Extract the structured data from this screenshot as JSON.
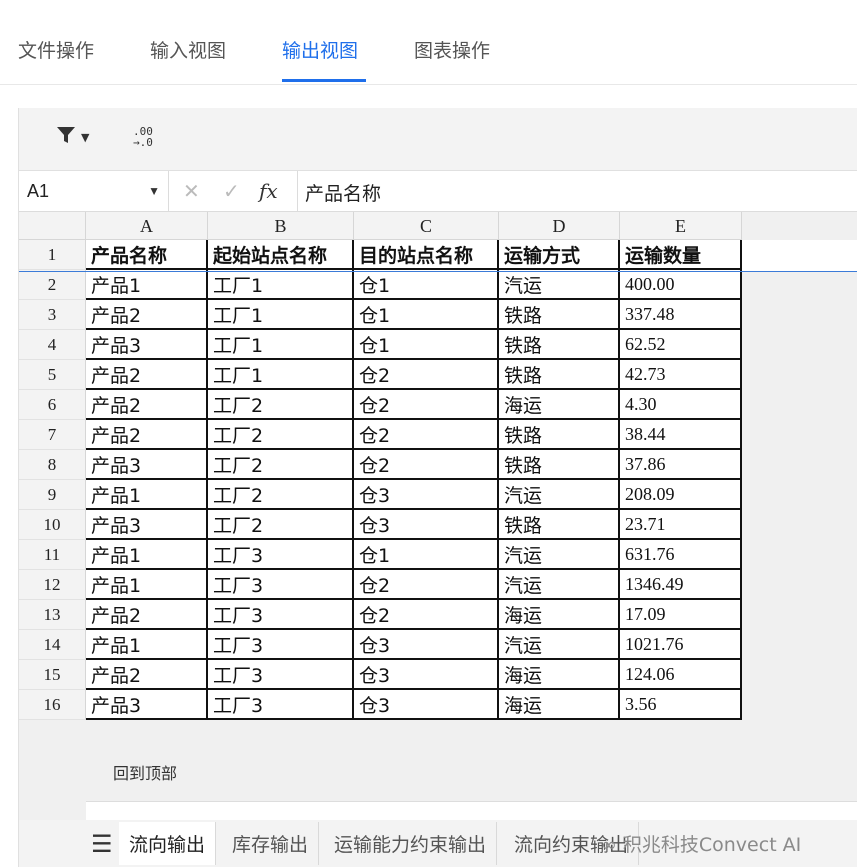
{
  "nav": {
    "tabs": [
      "文件操作",
      "输入视图",
      "输出视图",
      "图表操作"
    ],
    "active_index": 2
  },
  "toolbar": {
    "filter_icon": "filter-icon",
    "decimal_icon_text": ".00\n→.0"
  },
  "formula_bar": {
    "cell_ref": "A1",
    "content": "产品名称",
    "fx_label": "fx"
  },
  "grid": {
    "columns": [
      "A",
      "B",
      "C",
      "D",
      "E"
    ],
    "header_row": [
      "产品名称",
      "起始站点名称",
      "目的站点名称",
      "运输方式",
      "运输数量"
    ],
    "row_numbers": [
      "1",
      "2",
      "3",
      "4",
      "5",
      "6",
      "7",
      "8",
      "9",
      "10",
      "11",
      "12",
      "13",
      "14",
      "15",
      "16"
    ],
    "rows": [
      [
        "产品1",
        "工厂1",
        "仓1",
        "汽运",
        "400.00"
      ],
      [
        "产品2",
        "工厂1",
        "仓1",
        "铁路",
        "337.48"
      ],
      [
        "产品3",
        "工厂1",
        "仓1",
        "铁路",
        "62.52"
      ],
      [
        "产品2",
        "工厂1",
        "仓2",
        "铁路",
        "42.73"
      ],
      [
        "产品2",
        "工厂2",
        "仓2",
        "海运",
        "4.30"
      ],
      [
        "产品2",
        "工厂2",
        "仓2",
        "铁路",
        "38.44"
      ],
      [
        "产品3",
        "工厂2",
        "仓2",
        "铁路",
        "37.86"
      ],
      [
        "产品1",
        "工厂2",
        "仓3",
        "汽运",
        "208.09"
      ],
      [
        "产品3",
        "工厂2",
        "仓3",
        "铁路",
        "23.71"
      ],
      [
        "产品1",
        "工厂3",
        "仓1",
        "汽运",
        "631.76"
      ],
      [
        "产品1",
        "工厂3",
        "仓2",
        "汽运",
        "1346.49"
      ],
      [
        "产品2",
        "工厂3",
        "仓2",
        "海运",
        "17.09"
      ],
      [
        "产品1",
        "工厂3",
        "仓3",
        "汽运",
        "1021.76"
      ],
      [
        "产品2",
        "工厂3",
        "仓3",
        "海运",
        "124.06"
      ],
      [
        "产品3",
        "工厂3",
        "仓3",
        "海运",
        "3.56"
      ]
    ]
  },
  "back_to_top": "回到顶部",
  "sheet_tabs": [
    "流向输出",
    "库存输出",
    "运输能力约束输出",
    "流向约束输出"
  ],
  "active_sheet_index": 0,
  "watermark": "积兆科技Convect AI",
  "colors": {
    "accent": "#1f6feb",
    "grid_border": "#111111"
  }
}
